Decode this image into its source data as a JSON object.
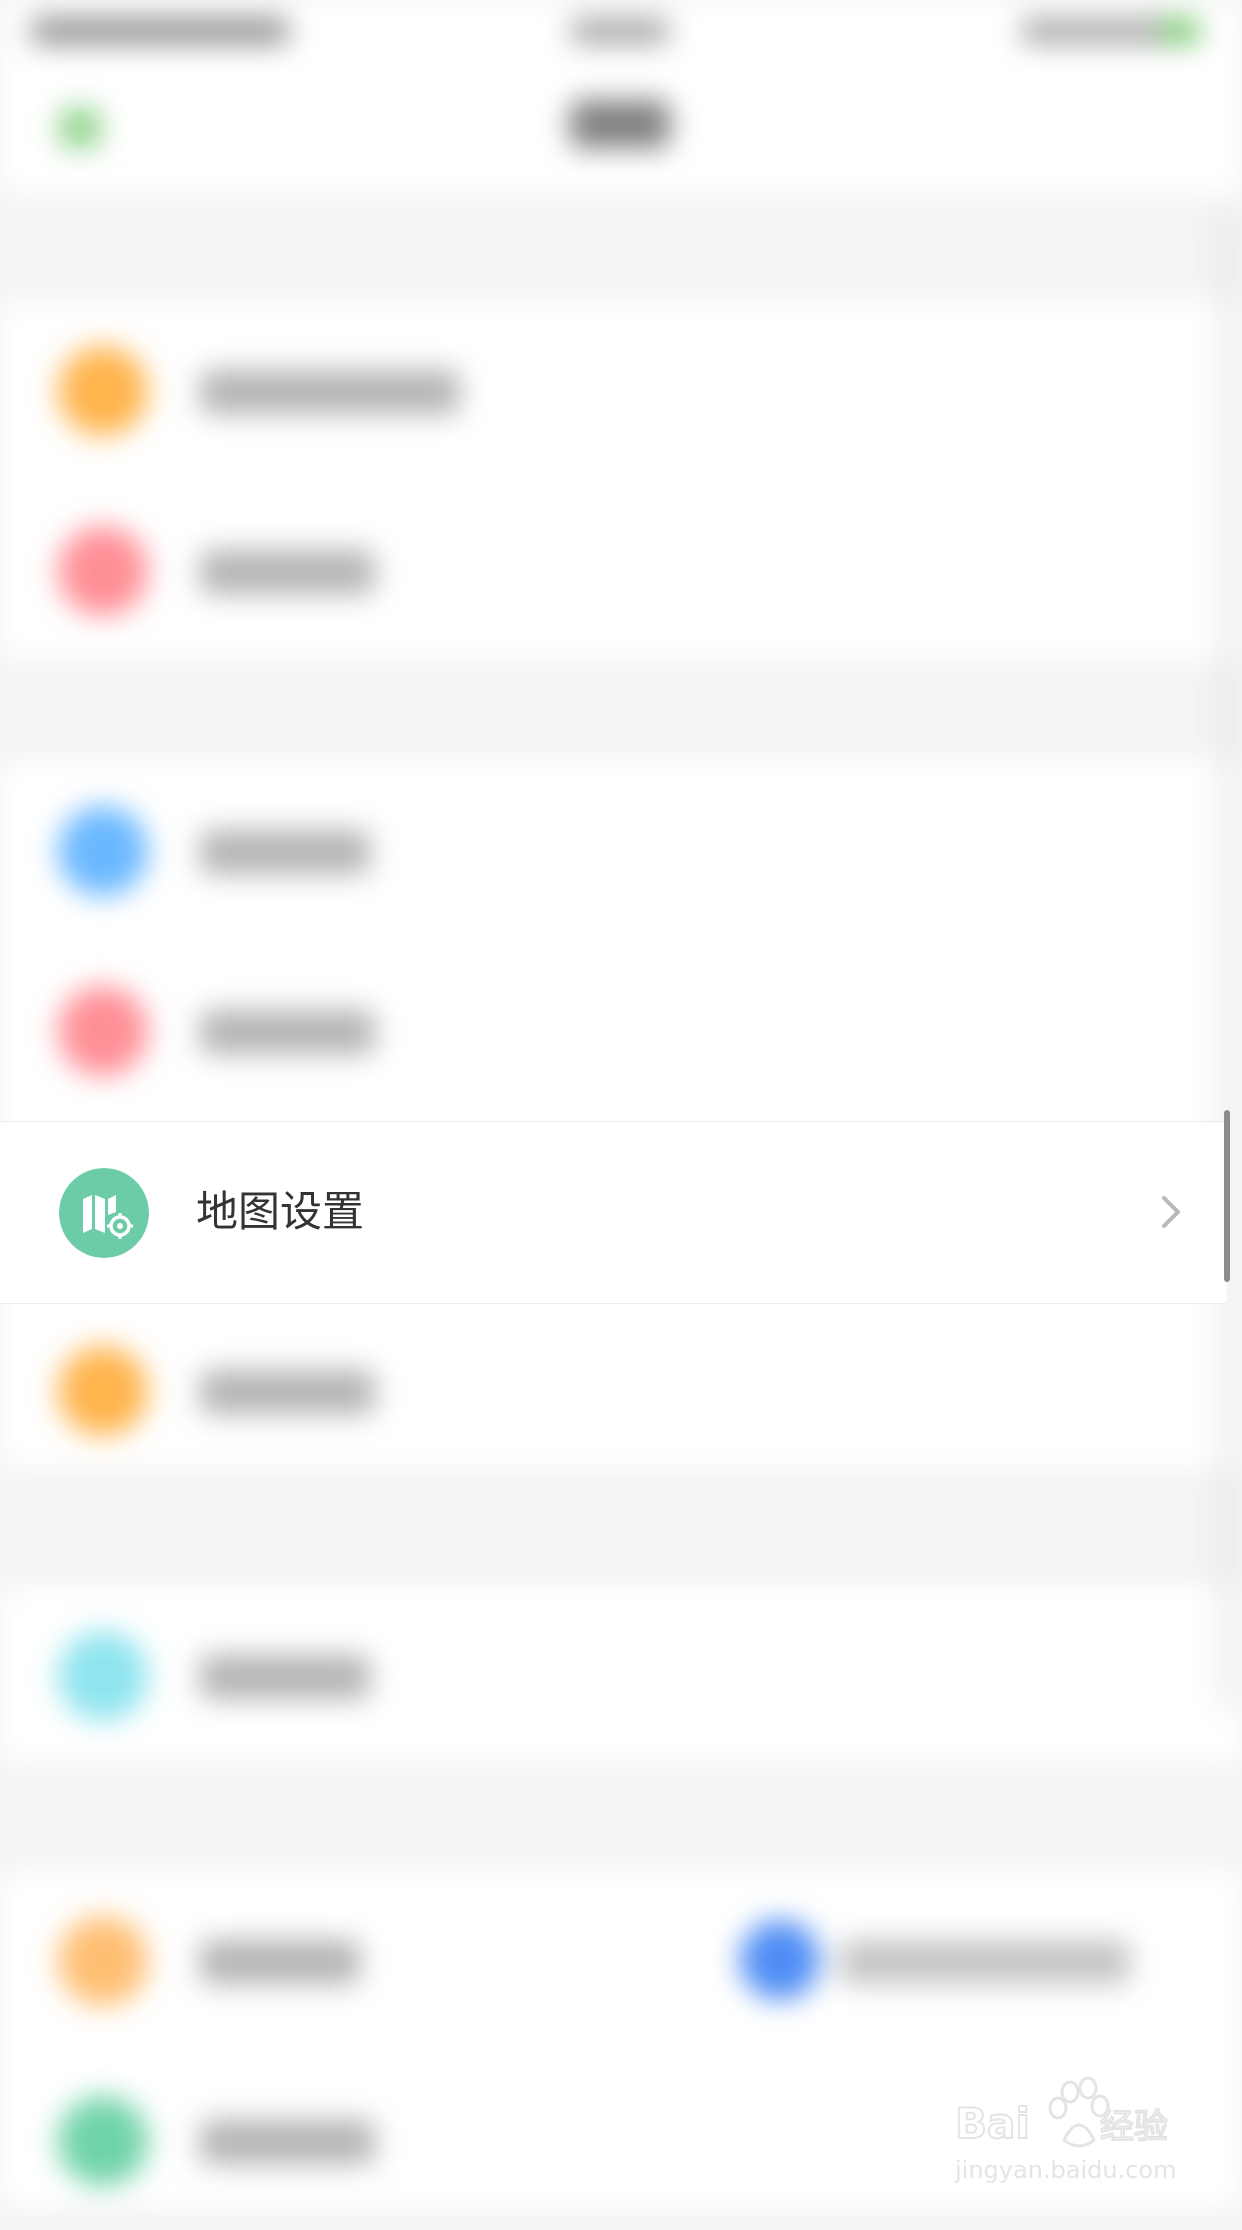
{
  "colors": {
    "background": "#f4f4f4",
    "row_background": "#ffffff",
    "map_icon_bg": "#6ccca7",
    "chevron": "#b8b8b8",
    "label": "#333333",
    "icon_orange": "#ffb44d",
    "icon_red": "#ff8f96",
    "icon_blue": "#6ab8ff",
    "icon_cyan": "#8fe4ef",
    "icon_green": "#6fd3a8",
    "icon_blue_small": "#4f8df5"
  },
  "focused_item": {
    "label": "地图设置",
    "icon": "map-settings-icon"
  },
  "watermark": {
    "brand": "Baidu",
    "brand_suffix": "经验",
    "url": "jingyan.baidu.com"
  }
}
